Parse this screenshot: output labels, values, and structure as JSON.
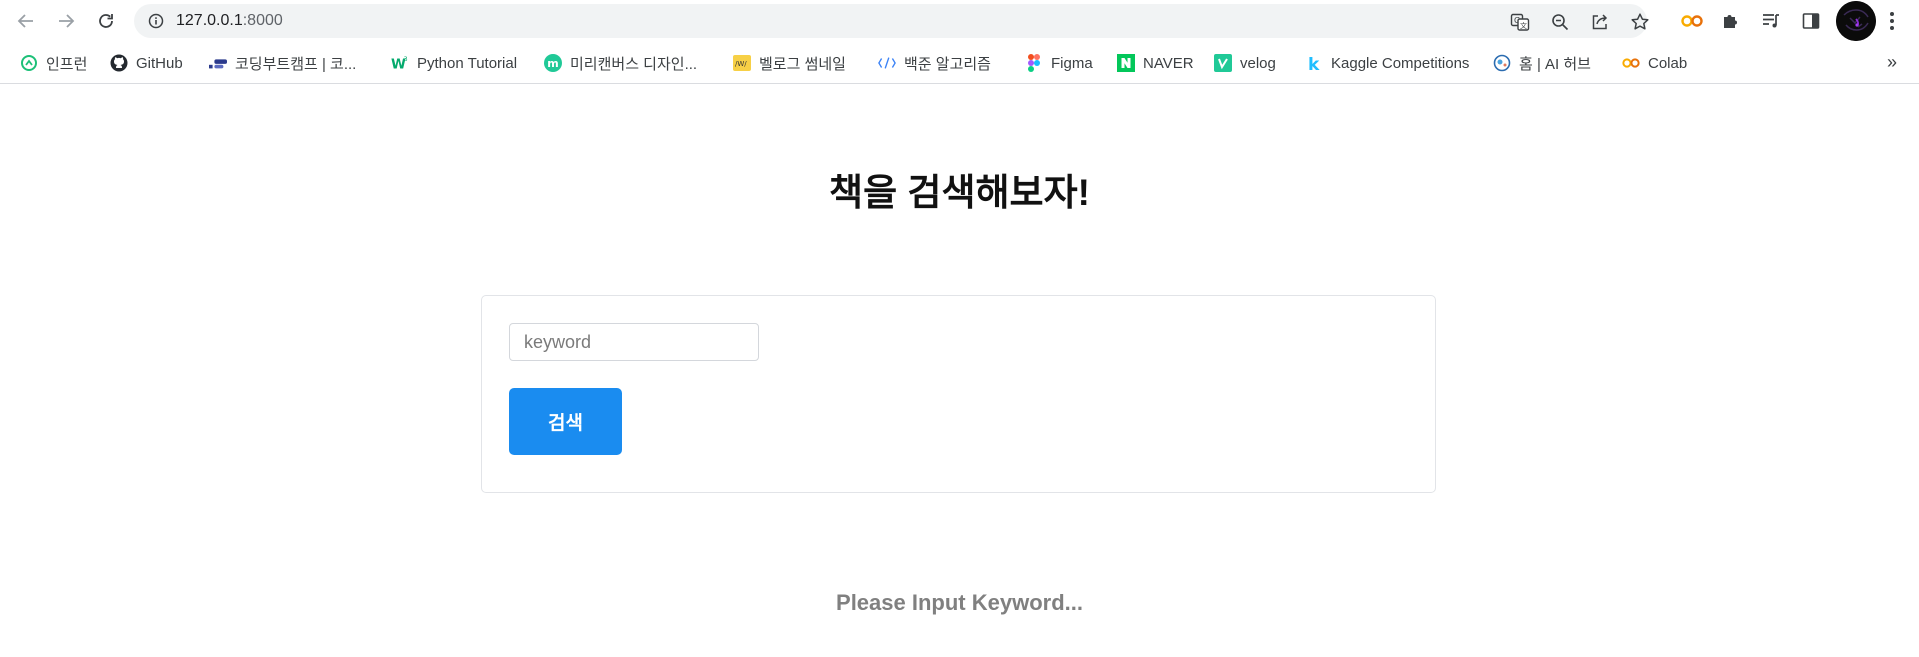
{
  "browser": {
    "url_host": "127.0.0.1",
    "url_port": ":8000",
    "icons": {
      "back": "back-arrow-icon",
      "forward": "forward-arrow-icon",
      "reload": "reload-icon",
      "site_info": "info-icon",
      "translate": "translate-icon",
      "zoom": "zoom-out-icon",
      "share": "share-icon",
      "bookmark": "star-icon"
    },
    "extensions": [
      "colab-icon",
      "puzzle-icon",
      "reading-list-icon",
      "side-panel-icon"
    ],
    "profile": "avatar",
    "menu": "more-vert-icon"
  },
  "bookmarks": {
    "items": [
      {
        "label": "인프런",
        "icon": "inflearn-icon",
        "color": "#1dc078"
      },
      {
        "label": "GitHub",
        "icon": "github-icon",
        "color": "#24292f"
      },
      {
        "label": "코딩부트캠프 | 코...",
        "icon": "bootcamp-icon",
        "color": "#2b3a8c"
      },
      {
        "label": "Python Tutorial",
        "icon": "w3schools-icon",
        "color": "#04aa6d"
      },
      {
        "label": "미리캔버스 디자인...",
        "icon": "miricanvas-icon",
        "color": "#20c997"
      },
      {
        "label": "벨로그 썸네일",
        "icon": "thumbnail-icon",
        "color": "#f7d046"
      },
      {
        "label": "백준 알고리즘",
        "icon": "code-icon",
        "color": "#3b82f6"
      },
      {
        "label": "Figma",
        "icon": "figma-icon",
        "color": "#f24e1e"
      },
      {
        "label": "NAVER",
        "icon": "naver-icon",
        "color": "#03c75a"
      },
      {
        "label": "velog",
        "icon": "velog-icon",
        "color": "#20c997"
      },
      {
        "label": "Kaggle Competitions",
        "icon": "kaggle-icon",
        "color": "#20beff"
      },
      {
        "label": "홈 | AI 허브",
        "icon": "aihub-icon",
        "color": "#2b6cb0"
      },
      {
        "label": "Colab",
        "icon": "colab-icon",
        "color": "#f9ab00"
      }
    ],
    "more": "»"
  },
  "page": {
    "title": "책을 검색해보자!",
    "search": {
      "placeholder": "keyword",
      "value": "",
      "button_label": "검색",
      "button_color": "#1a8cf0"
    },
    "result_message": "Please Input Keyword..."
  }
}
